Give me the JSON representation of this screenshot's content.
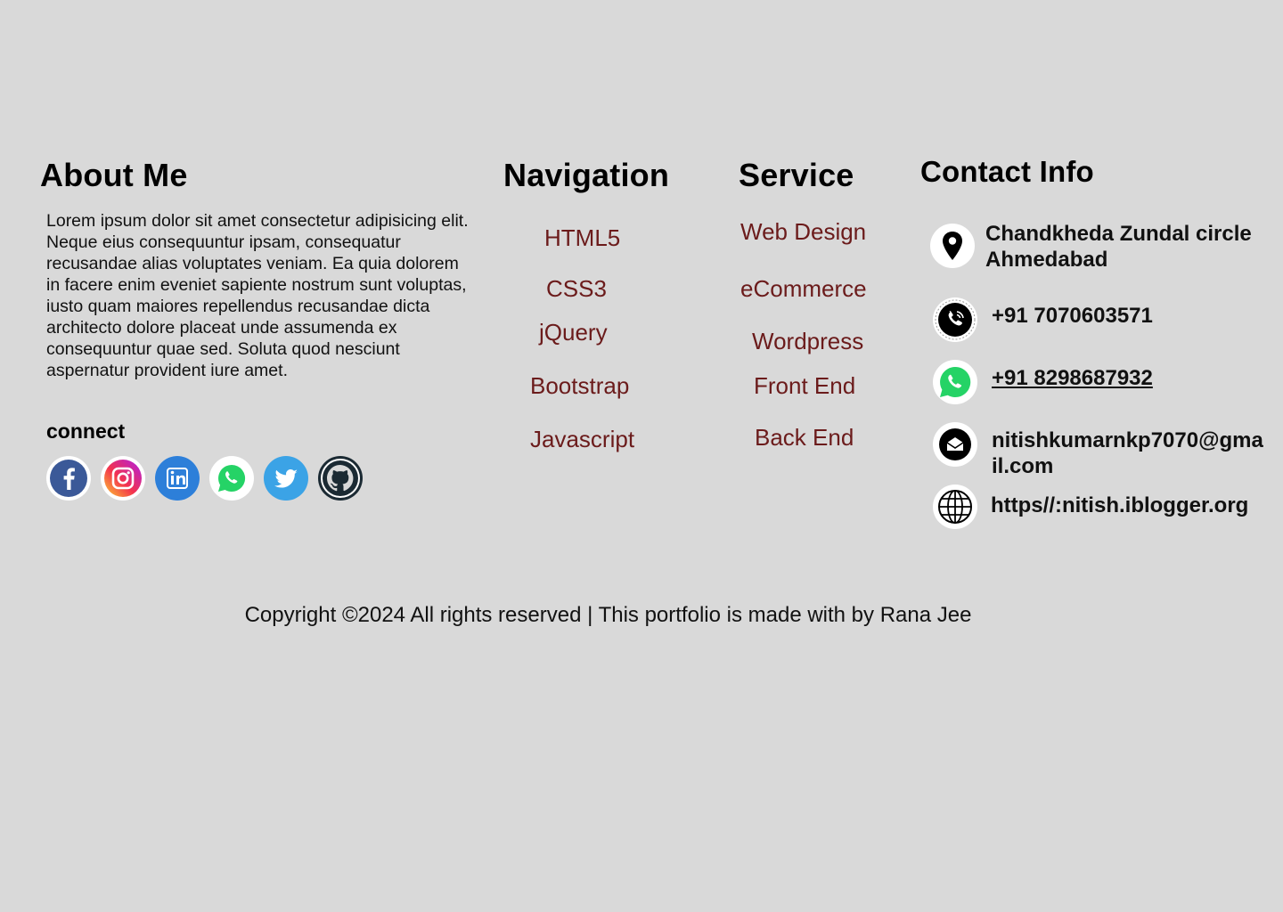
{
  "about": {
    "heading": "About Me",
    "text": "Lorem ipsum dolor sit amet consectetur adipisicing elit. Neque eius consequuntur ipsam, consequatur recusandae alias voluptates veniam. Ea quia dolorem in facere enim eveniet sapiente nostrum sunt voluptas, iusto quam maiores repellendus recusandae dicta architecto dolore placeat unde assumenda ex consequuntur quae sed. Soluta quod nesciunt aspernatur provident iure amet.",
    "connect_label": "connect",
    "socials": [
      {
        "name": "facebook-icon",
        "color": "#3b5998"
      },
      {
        "name": "instagram-icon",
        "color": "#e1306c"
      },
      {
        "name": "linkedin-icon",
        "color": "#2d7fd9"
      },
      {
        "name": "whatsapp-icon",
        "color": "#25d366"
      },
      {
        "name": "twitter-icon",
        "color": "#3ba3e6"
      },
      {
        "name": "github-icon",
        "color": "#1b2a33"
      }
    ]
  },
  "navigation": {
    "heading": "Navigation",
    "items": [
      "HTML5",
      "CSS3",
      "jQuery",
      "Bootstrap",
      "Javascript"
    ]
  },
  "service": {
    "heading": "Service",
    "items": [
      "Web Design",
      "eCommerce",
      "Wordpress",
      "Front End",
      "Back End"
    ]
  },
  "contact": {
    "heading": "Contact Info",
    "address": "Chandkheda Zundal circle Ahmedabad",
    "phone": "+91 7070603571",
    "whatsapp": "+91 8298687932",
    "email": "nitishkumarnkp7070@gmail.com",
    "website": "https//:nitish.iblogger.org"
  },
  "footer": {
    "copyright": "Copyright ©2024 All rights reserved | This portfolio is made with by Rana Jee"
  },
  "colors": {
    "background": "#d9d9d9",
    "link": "#6b1b1b"
  }
}
